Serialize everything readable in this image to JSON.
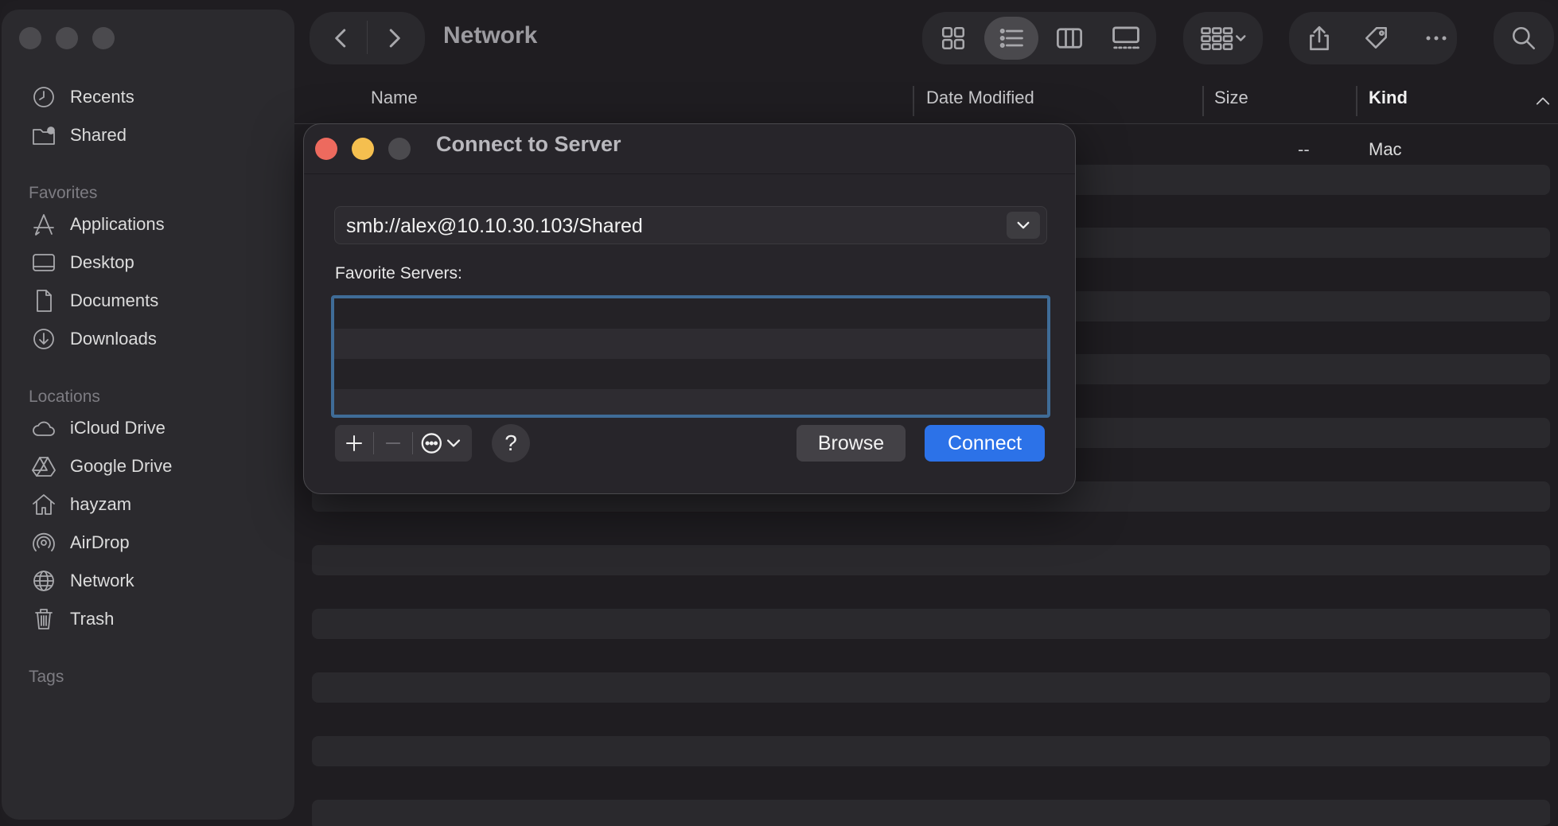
{
  "finder": {
    "title": "Network",
    "sidebar": {
      "top_items": [
        {
          "label": "Recents",
          "icon": "clock-icon"
        },
        {
          "label": "Shared",
          "icon": "shared-folder-icon"
        }
      ],
      "favorites_heading": "Favorites",
      "favorites": [
        {
          "label": "Applications",
          "icon": "applications-icon"
        },
        {
          "label": "Desktop",
          "icon": "desktop-icon"
        },
        {
          "label": "Documents",
          "icon": "document-icon"
        },
        {
          "label": "Downloads",
          "icon": "download-icon"
        }
      ],
      "locations_heading": "Locations",
      "locations": [
        {
          "label": "iCloud Drive",
          "icon": "cloud-icon"
        },
        {
          "label": "Google Drive",
          "icon": "google-drive-icon"
        },
        {
          "label": "hayzam",
          "icon": "home-icon"
        },
        {
          "label": "AirDrop",
          "icon": "airdrop-icon"
        },
        {
          "label": "Network",
          "icon": "globe-icon"
        },
        {
          "label": "Trash",
          "icon": "trash-icon"
        }
      ],
      "tags_heading": "Tags"
    },
    "columns": {
      "name": "Name",
      "date_modified": "Date Modified",
      "size": "Size",
      "kind": "Kind"
    },
    "first_row": {
      "size": "--",
      "kind": "Mac"
    }
  },
  "dialog": {
    "title": "Connect to Server",
    "server_address": "smb://alex@10.10.30.103/Shared",
    "favorite_servers_label": "Favorite Servers:",
    "help_label": "?",
    "browse_label": "Browse",
    "connect_label": "Connect"
  },
  "colors": {
    "accent": "#2c72e8",
    "close": "#ed6a5e",
    "minimize": "#f5bf4f",
    "focus_ring": "#3f6c97"
  }
}
